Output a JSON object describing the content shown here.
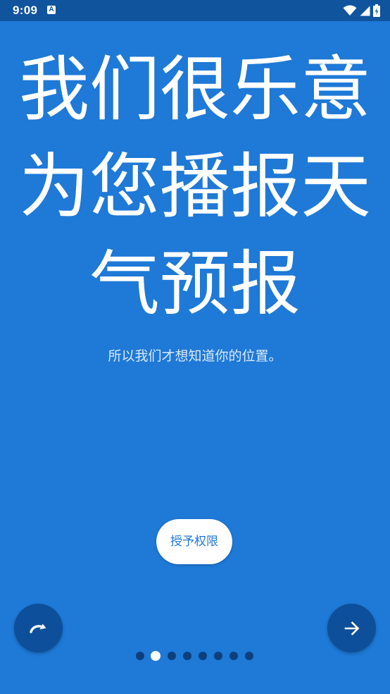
{
  "status_bar": {
    "time": "9:09",
    "notification_letter": "A",
    "icons": [
      "wifi-icon",
      "signal-icon",
      "battery-icon"
    ]
  },
  "onboarding": {
    "headline_lines": [
      "我们很乐意",
      "为您播报天",
      "气预报"
    ],
    "subtitle": "所以我们才想知道你的位置。",
    "grant_button_label": "授予权限",
    "skip_icon": "redo-arrow-icon",
    "next_icon": "arrow-right-icon",
    "page_indicator": {
      "total": 8,
      "active_index": 1
    }
  },
  "colors": {
    "background": "#1e79d7",
    "status_bar": "#11549e",
    "round_button": "#0d4f9a",
    "inactive_dot": "#0d3f7d",
    "active_dot": "#ffffff"
  }
}
